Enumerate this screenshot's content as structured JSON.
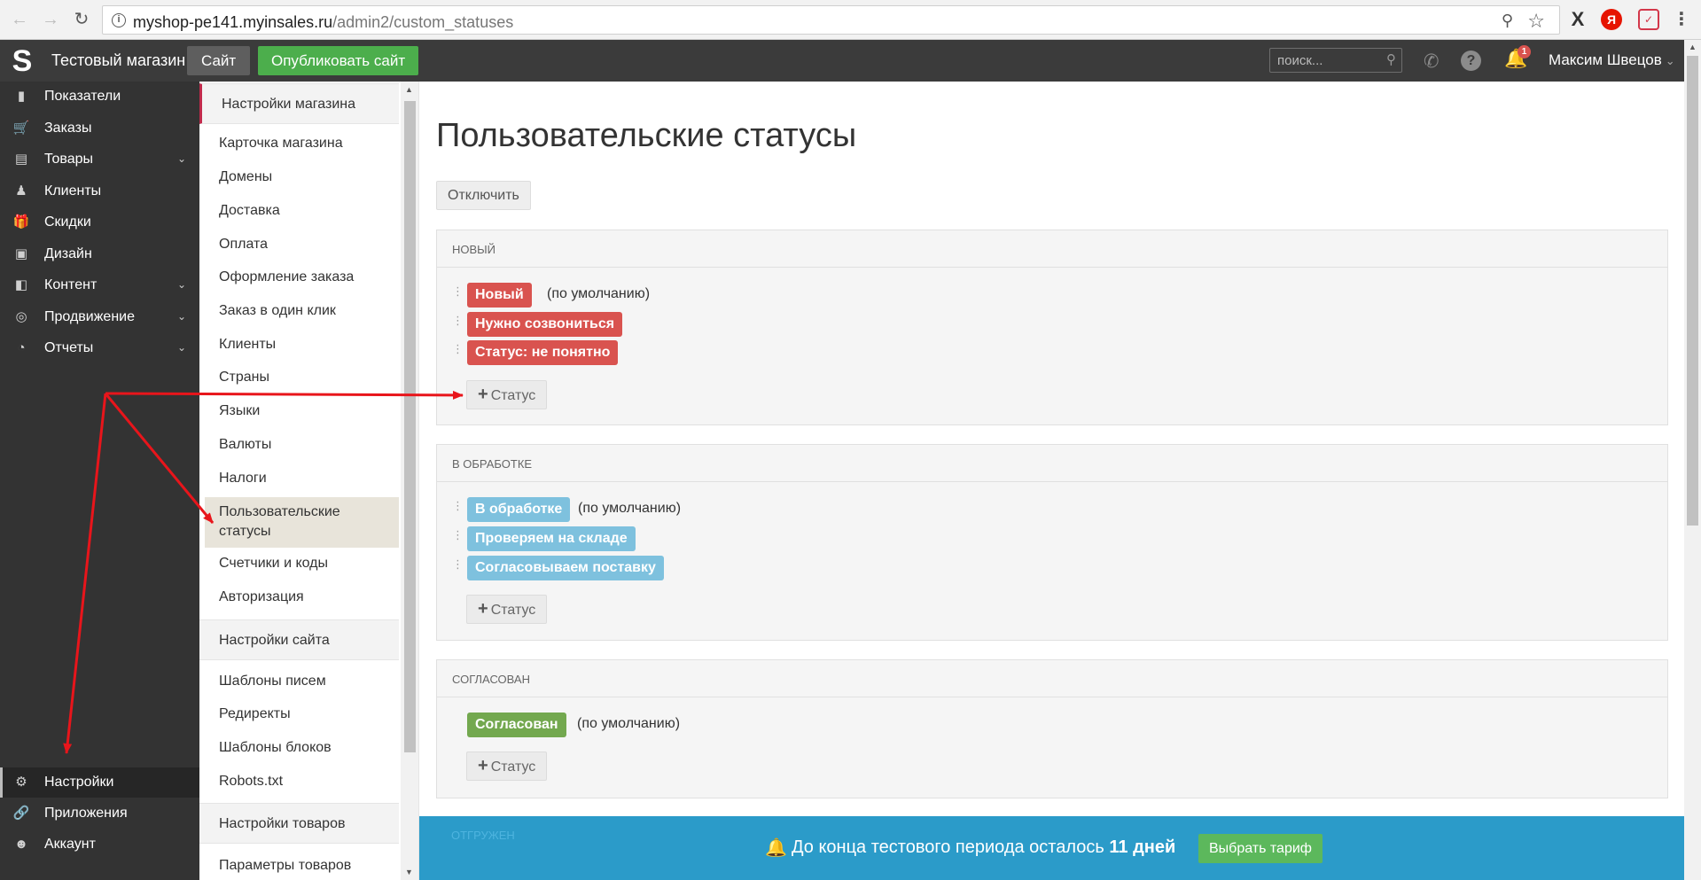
{
  "browser": {
    "url_host": "myshop-pe141.myinsales.ru",
    "url_path": "/admin2/custom_statuses"
  },
  "topbar": {
    "shop_name": "Тестовый магазин",
    "site_label": "Сайт",
    "publish_label": "Опубликовать сайт",
    "search_placeholder": "поиск...",
    "notifications_count": "1",
    "user_name": "Максим Швецов"
  },
  "sidebar": {
    "items": [
      {
        "label": "Показатели",
        "icon": "bar-chart-icon"
      },
      {
        "label": "Заказы",
        "icon": "cart-icon"
      },
      {
        "label": "Товары",
        "icon": "products-icon"
      },
      {
        "label": "Клиенты",
        "icon": "users-icon"
      },
      {
        "label": "Скидки",
        "icon": "gift-icon"
      },
      {
        "label": "Дизайн",
        "icon": "image-icon"
      },
      {
        "label": "Контент",
        "icon": "content-icon"
      },
      {
        "label": "Продвижение",
        "icon": "target-icon"
      },
      {
        "label": "Отчеты",
        "icon": "pie-chart-icon"
      }
    ],
    "bottom_items": [
      {
        "label": "Настройки",
        "icon": "gear-icon"
      },
      {
        "label": "Приложения",
        "icon": "link-icon"
      },
      {
        "label": "Аккаунт",
        "icon": "user-icon"
      }
    ]
  },
  "submenu": {
    "store_header": "Настройки магазина",
    "store_items": [
      "Карточка магазина",
      "Домены",
      "Доставка",
      "Оплата",
      "Оформление заказа",
      "Заказ в один клик",
      "Клиенты",
      "Страны",
      "Языки",
      "Валюты",
      "Налоги",
      "Пользовательские статусы",
      "Счетчики и коды",
      "Авторизация"
    ],
    "site_header": "Настройки сайта",
    "site_items": [
      "Шаблоны писем",
      "Редиректы",
      "Шаблоны блоков",
      "Robots.txt"
    ],
    "products_header": "Настройки товаров",
    "products_items": [
      "Параметры товаров"
    ]
  },
  "main": {
    "title": "Пользовательские статусы",
    "disable_label": "Отключить",
    "add_status_label": "Статус",
    "default_note": "(по умолчанию)",
    "groups": [
      {
        "head": "НОВЫЙ",
        "statuses": [
          "Новый",
          "Нужно созвониться",
          "Статус: не понятно"
        ]
      },
      {
        "head": "В ОБРАБОТКЕ",
        "statuses": [
          "В обработке",
          "Проверяем на складе",
          "Согласовываем поставку"
        ]
      },
      {
        "head": "СОГЛАСОВАН",
        "statuses": [
          "Согласован"
        ]
      },
      {
        "head": "ОТГРУЖЕН"
      }
    ]
  },
  "banner": {
    "text_before": "До конца тестового периода осталось",
    "text_bold": "11 дней",
    "button_label": "Выбрать тариф"
  },
  "colors": {
    "topbar": "#3b3b3b",
    "sidebar": "#333333",
    "status_new": "#d9534f",
    "status_processing": "#7ec1de",
    "status_agreed": "#73a84f",
    "banner": "#2b9bc9",
    "annotation_arrow": "#e8151b"
  }
}
